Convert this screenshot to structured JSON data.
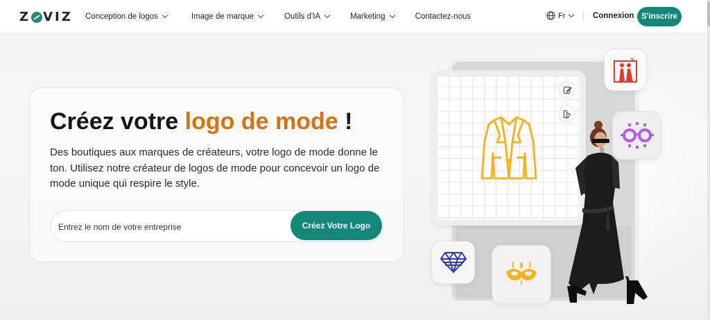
{
  "header": {
    "logo_text": "ZOVIZ",
    "nav": [
      {
        "label": "Conception de logos",
        "has_dropdown": true
      },
      {
        "label": "Image de marque",
        "has_dropdown": true
      },
      {
        "label": "Outils d'IA",
        "has_dropdown": true
      },
      {
        "label": "Marketing",
        "has_dropdown": true
      },
      {
        "label": "Contactez-nous",
        "has_dropdown": false
      }
    ],
    "language": "Fr",
    "login_label": "Connexion",
    "signup_label": "S'inscrire"
  },
  "hero": {
    "title_start": "Créez votre ",
    "title_accent": "logo de mode",
    "title_end": " !",
    "description": "Des boutiques aux marques de créateurs, votre logo de mode donne le ton. Utilisez notre créateur de logos de mode pour concevoir un logo de mode unique qui respire le style.",
    "input_placeholder": "Entrez le nom de votre entreprise",
    "cta_label": "Créez Votre Logo"
  },
  "illustration": {
    "icons": [
      "jacket-icon",
      "edit-icon",
      "palette-icon",
      "couple-icon",
      "sunglasses-icon",
      "diamond-icon",
      "mask-icon"
    ]
  },
  "colors": {
    "brand": "#13877a",
    "accent": "#d8720e",
    "jacket": "#f5b324",
    "diamond": "#2f3aa8",
    "sunglasses": "#b35ae8",
    "couple": "#e23b2a"
  }
}
